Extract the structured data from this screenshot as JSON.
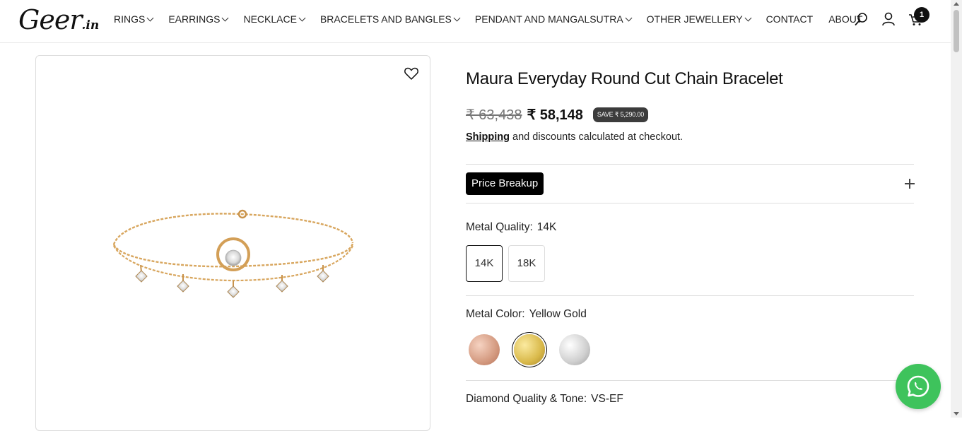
{
  "header": {
    "logo_main": "Geer",
    "logo_suffix": ".in",
    "nav": [
      {
        "label": "RINGS",
        "dropdown": true
      },
      {
        "label": "EARRINGS",
        "dropdown": true
      },
      {
        "label": "NECKLACE",
        "dropdown": true
      },
      {
        "label": "BRACELETS AND BANGLES",
        "dropdown": true
      },
      {
        "label": "PENDANT AND MANGALSUTRA",
        "dropdown": true
      },
      {
        "label": "OTHER JEWELLERY",
        "dropdown": true
      },
      {
        "label": "CONTACT",
        "dropdown": false
      },
      {
        "label": "ABOUT",
        "dropdown": false
      }
    ],
    "icons": [
      "search-icon",
      "account-icon",
      "cart-icon"
    ],
    "cart_count": "1"
  },
  "product": {
    "title": "Maura Everyday Round Cut Chain Bracelet",
    "old_price": "₹ 63,438",
    "new_price": "₹ 58,148",
    "save_badge": "SAVE ₹ 5,290.00",
    "shipping_link": "Shipping",
    "shipping_rest": "and discounts calculated at checkout.",
    "price_breakup_label": "Price Breakup",
    "metal_quality_label": "Metal Quality:",
    "metal_quality_value": "14K",
    "metal_quality_options": [
      "14K",
      "18K"
    ],
    "metal_color_label": "Metal Color:",
    "metal_color_value": "Yellow Gold",
    "metal_colors": [
      {
        "name": "Rose Gold",
        "color": "#d49a80"
      },
      {
        "name": "Yellow Gold",
        "color": "#d9b94a"
      },
      {
        "name": "White Gold",
        "color": "#cfcfcf"
      }
    ],
    "diamond_quality_label": "Diamond Quality & Tone:",
    "diamond_quality_value": "VS-EF"
  },
  "colors": {
    "accent": "#000000",
    "whatsapp": "#3ec35c",
    "badge": "#3c3c3c"
  }
}
